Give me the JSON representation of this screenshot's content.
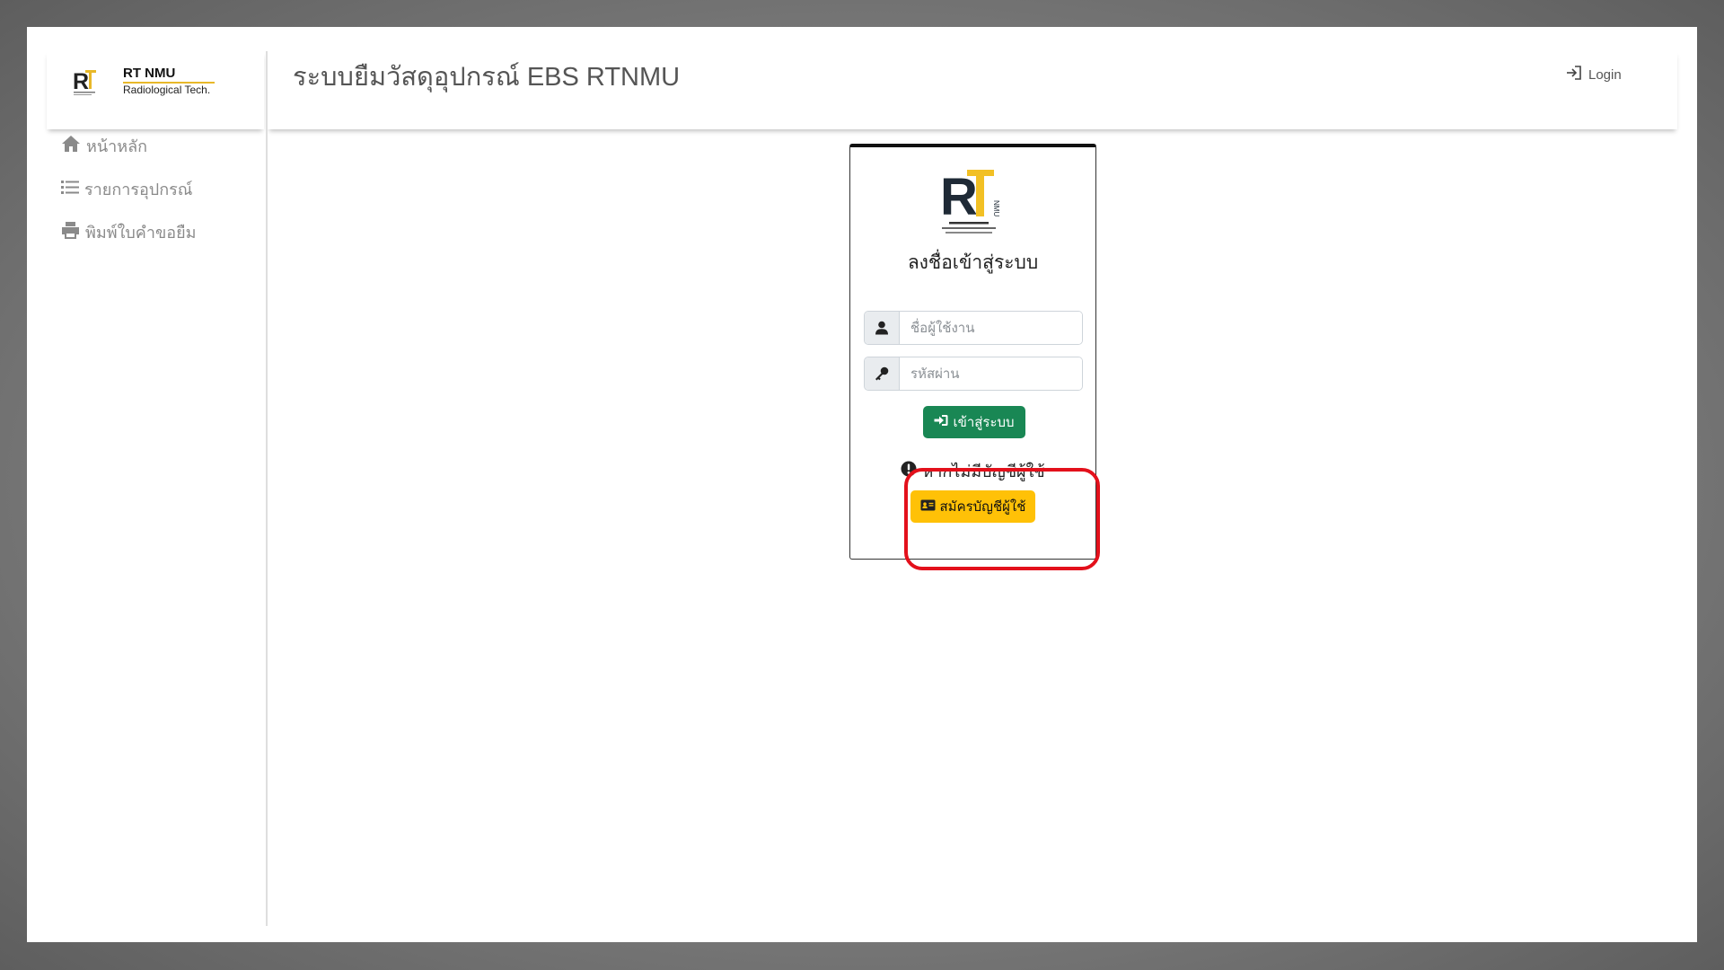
{
  "sidebar": {
    "logo": {
      "title": "RT NMU",
      "subtitle": "Radiological Tech."
    },
    "items": [
      {
        "label": "หน้าหลัก",
        "icon": "home-icon"
      },
      {
        "label": "รายการอุปกรณ์",
        "icon": "list-icon"
      },
      {
        "label": "พิมพ์ใบคำขอยืม",
        "icon": "printer-icon"
      }
    ]
  },
  "header": {
    "title": "ระบบยืมวัสดุอุปกรณ์ EBS RTNMU",
    "login_label": "Login",
    "login_icon": "sign-in-icon"
  },
  "login_card": {
    "logo_icon": "rt-nmu-logo",
    "heading": "ลงชื่อเข้าสู่ระบบ",
    "username": {
      "placeholder": "ชื่อผู้ใช้งาน",
      "value": "",
      "icon": "user-icon"
    },
    "password": {
      "placeholder": "รหัสผ่าน",
      "value": "",
      "icon": "key-icon"
    },
    "login_button": "เข้าสู่ระบบ",
    "login_button_color": "#198754",
    "no_account_text": "หากไม่มีบัญชีผู้ใช้",
    "register_button": "สมัครบัญชีผู้ใช้",
    "register_button_color": "#ffc107"
  },
  "colors": {
    "highlight": "#e3101b",
    "logo_accent": "#e8b829"
  }
}
